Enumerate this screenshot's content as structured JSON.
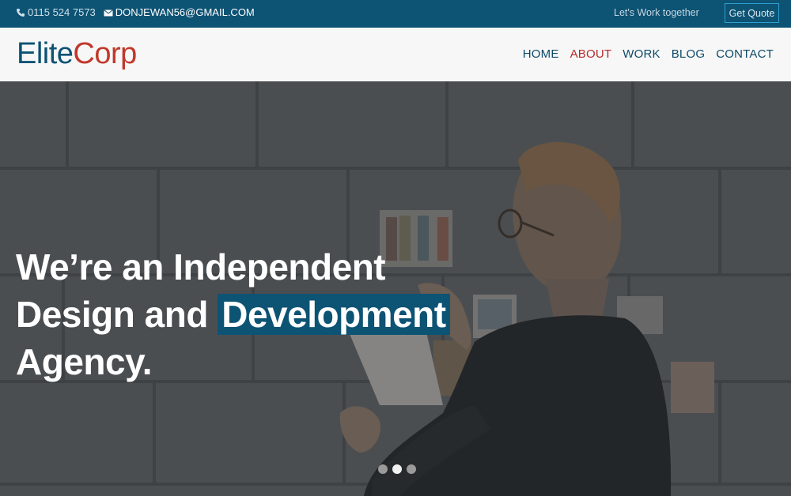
{
  "topbar": {
    "phone": "0115 524 7573",
    "email": "DONJEWAN56@GMAIL.COM",
    "tagline": "Let's Work together",
    "quote_button": "Get Quote",
    "icons": [
      "phone-icon",
      "envelope-icon"
    ]
  },
  "header": {
    "logo_part1": "Elite",
    "logo_part2": "Corp",
    "nav": [
      {
        "label": "HOME",
        "active": false
      },
      {
        "label": "ABOUT",
        "active": true
      },
      {
        "label": "WORK",
        "active": false
      },
      {
        "label": "BLOG",
        "active": false
      },
      {
        "label": "CONTACT",
        "active": false
      }
    ]
  },
  "hero": {
    "line1": "We’re an Independent",
    "line2_plain": "Design and ",
    "line2_highlight": "Development",
    "line3": "Agency.",
    "slides_total": 3,
    "slide_active": 2
  },
  "colors": {
    "brand": "#0d5374",
    "accent_red": "#c0392b",
    "topbar_bg": "#0d5374",
    "header_bg": "#f7f7f7"
  }
}
